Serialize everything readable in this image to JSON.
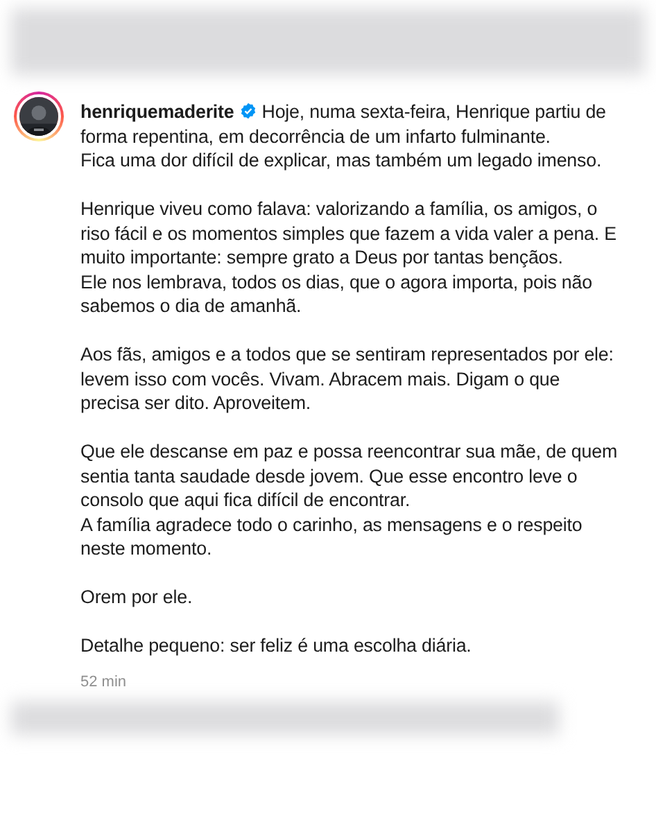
{
  "post": {
    "username": "henriquemaderite",
    "verified": true,
    "paragraphs": [
      [
        "Hoje, numa sexta-feira, Henrique partiu de",
        "forma repentina, em decorrência de um infarto fulminante.",
        "Fica uma dor difícil de explicar, mas também um legado imenso."
      ],
      [
        "Henrique viveu como falava: valorizando a família, os amigos, o",
        "riso fácil e os momentos simples que fazem a vida valer a pena. E",
        "muito importante: sempre grato a Deus por tantas bençãos.",
        "Ele nos lembrava, todos os dias, que o agora importa, pois não",
        "sabemos o dia de amanhã."
      ],
      [
        "Aos fãs, amigos e a todos que se sentiram representados por ele:",
        "levem isso com vocês. Vivam. Abracem mais. Digam o que",
        "precisa ser dito. Aproveitem."
      ],
      [
        "Que ele descanse em paz e possa reencontrar sua mãe, de quem",
        "sentia tanta saudade desde jovem. Que esse encontro leve o",
        "consolo que aqui fica difícil de encontrar.",
        "A família agradece todo o carinho, as mensagens e o respeito",
        "neste momento."
      ],
      [
        "Orem por ele."
      ],
      [
        "Detalhe pequeno: ser feliz é uma escolha diária."
      ]
    ],
    "time": "52 min"
  }
}
